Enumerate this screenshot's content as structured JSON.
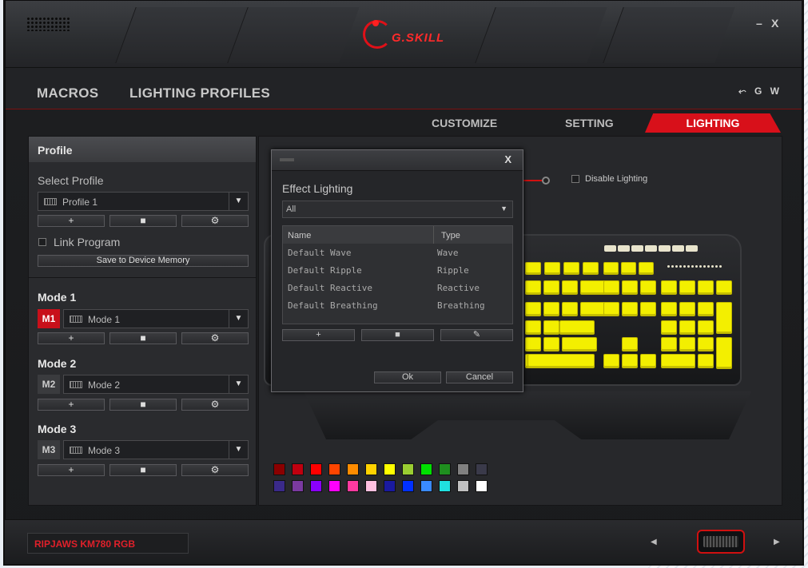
{
  "window": {
    "brand": "G.SKILL",
    "minimize": "–",
    "close": "X"
  },
  "nav": {
    "tabs": [
      "MACROS",
      "LIGHTING PROFILES"
    ],
    "right_icons": [
      "share-icon",
      "G",
      "W"
    ],
    "right_letters": [
      "G",
      "W"
    ]
  },
  "subtabs": [
    "CUSTOMIZE",
    "SETTING",
    "LIGHTING"
  ],
  "sidebar": {
    "header": "Profile",
    "select_profile_label": "Select Profile",
    "profile_value": "Profile 1",
    "link_program_label": "Link Program",
    "save_button": "Save to Device Memory",
    "add": "+",
    "delete": "■",
    "settings": "⚙",
    "modes": [
      {
        "title": "Mode 1",
        "badge": "M1",
        "value": "Mode 1",
        "active": true
      },
      {
        "title": "Mode 2",
        "badge": "M2",
        "value": "Mode 2",
        "active": false
      },
      {
        "title": "Mode 3",
        "badge": "M3",
        "value": "Mode 3",
        "active": false
      }
    ]
  },
  "lighting": {
    "disable_label": "Disable Lighting",
    "disabled": false,
    "palette_row1": [
      "#8b0000",
      "#c0000f",
      "#ff0000",
      "#ff4500",
      "#ff8c00",
      "#ffd200",
      "#ffff00",
      "#9acd32",
      "#00e000",
      "#1f8f1f",
      "#808080",
      "#3a3a4a"
    ],
    "palette_row2": [
      "#3a2a8a",
      "#7a3aa0",
      "#8a00ff",
      "#ff00ff",
      "#ff3aa0",
      "#ffc0e0",
      "#1a1aa0",
      "#0030ff",
      "#3a8aff",
      "#20e0e0",
      "#c0c0c0",
      "#ffffff"
    ],
    "key_color": "#f3ef00"
  },
  "dialog": {
    "close": "X",
    "title": "Effect Lighting",
    "filter": "All",
    "columns": [
      "Name",
      "Type"
    ],
    "rows": [
      {
        "name": "Default Wave",
        "type": "Wave"
      },
      {
        "name": "Default Ripple",
        "type": "Ripple"
      },
      {
        "name": "Default Reactive",
        "type": "Reactive"
      },
      {
        "name": "Default Breathing",
        "type": "Breathing"
      }
    ],
    "add": "+",
    "delete": "■",
    "edit": "✎",
    "ok": "Ok",
    "cancel": "Cancel"
  },
  "footer": {
    "model": "RIPJAWS KM780 RGB",
    "prev": "◀",
    "next": "▶"
  },
  "colors": {
    "accent": "#d8101a"
  }
}
